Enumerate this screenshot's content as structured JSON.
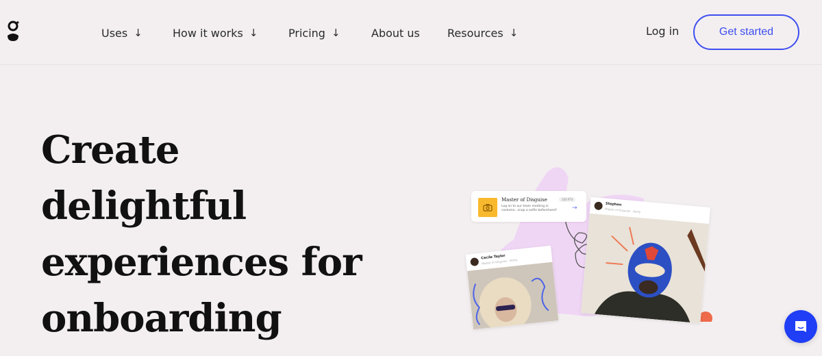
{
  "header": {
    "logo_alt": "g",
    "nav": [
      {
        "label": "Uses",
        "has_dropdown": true
      },
      {
        "label": "How it works",
        "has_dropdown": true
      },
      {
        "label": "Pricing",
        "has_dropdown": true
      },
      {
        "label": "About us",
        "has_dropdown": false
      },
      {
        "label": "Resources",
        "has_dropdown": true
      }
    ],
    "dropdown_arrow": "↓",
    "login_label": "Log in",
    "cta_label": "Get started"
  },
  "hero": {
    "title_lines": [
      "Create",
      "delightful",
      "experiences for",
      "onboarding"
    ]
  },
  "illustration": {
    "task_card": {
      "title": "Master of Disguise",
      "badge": "100 PTS",
      "description": "Log on to our team meeting in costume...snap a selfie beforehand!",
      "arrow": "→"
    },
    "posts": [
      {
        "name": "Cecile Taylor",
        "subtitle": "Master of Disguise · Verify"
      },
      {
        "name": "Stephen",
        "subtitle": "Master of Disguise · Verify"
      }
    ]
  },
  "colors": {
    "background": "#f3eff0",
    "accent": "#3d4df0",
    "chat_button": "#1f3ef5",
    "task_icon": "#f9b92e",
    "blob": "#f0d6f5"
  },
  "chat_widget": {
    "icon": "chat-icon"
  }
}
